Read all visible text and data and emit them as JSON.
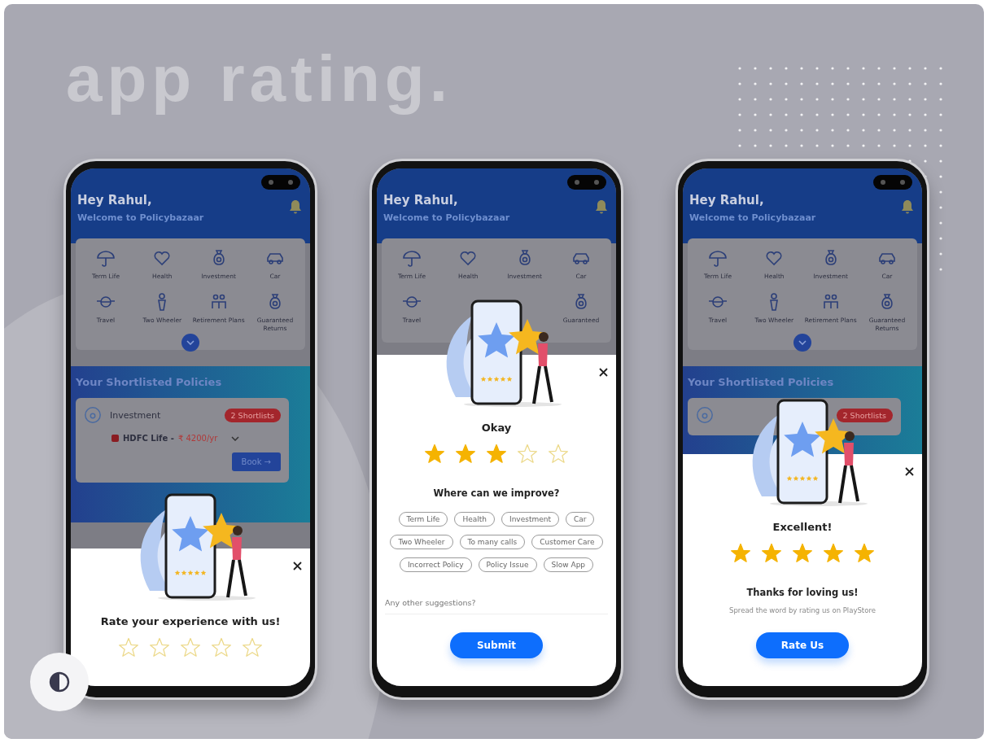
{
  "heading": "app rating.",
  "phones": [
    {
      "home": {
        "greeting": "Hey Rahul,",
        "welcome": "Welcome to Policybazaar",
        "category_rows": [
          [
            {
              "label": "Term Life",
              "kind": "umbrella"
            },
            {
              "label": "Health",
              "kind": "heart"
            },
            {
              "label": "Investment",
              "kind": "bag"
            },
            {
              "label": "Car",
              "kind": "car"
            }
          ],
          [
            {
              "label": "Travel",
              "kind": "globe"
            },
            {
              "label": "Two Wheeler",
              "kind": "person"
            },
            {
              "label": "Retirement Plans",
              "kind": "people"
            },
            {
              "label": "Guaranteed Returns",
              "kind": "bag"
            }
          ]
        ],
        "section_title": "Your Shortlisted Policies",
        "policy_card": {
          "title": "Investment",
          "badge": "2 Shortlists",
          "insurer": "HDFC Life -",
          "price": "₹ 4200/yr",
          "button": "Book →"
        }
      },
      "sheet": {
        "kind": "rate",
        "title": "Rate your experience with us!",
        "stars": 0
      }
    },
    {
      "home": {
        "greeting": "Hey Rahul,",
        "welcome": "Welcome to Policybazaar",
        "category_rows": [
          [
            {
              "label": "Term Life",
              "kind": "umbrella"
            },
            {
              "label": "Health",
              "kind": "heart"
            },
            {
              "label": "Investment",
              "kind": "bag"
            },
            {
              "label": "Car",
              "kind": "car"
            }
          ],
          [
            {
              "label": "Travel",
              "kind": "globe"
            },
            {
              "label": "Guaranteed",
              "kind": "bag"
            }
          ]
        ]
      },
      "sheet": {
        "kind": "feedback",
        "title": "Okay",
        "stars": 3,
        "question": "Where can we improve?",
        "chips": [
          "Term Life",
          "Health",
          "Investment",
          "Car",
          "Two Wheeler",
          "To many calls",
          "Customer Care",
          "Incorrect Policy",
          "Policy Issue",
          "Slow App"
        ],
        "placeholder": "Any other suggestions?",
        "button": "Submit"
      }
    },
    {
      "home": {
        "greeting": "Hey Rahul,",
        "welcome": "Welcome to Policybazaar",
        "category_rows": [
          [
            {
              "label": "Term Life",
              "kind": "umbrella"
            },
            {
              "label": "Health",
              "kind": "heart"
            },
            {
              "label": "Investment",
              "kind": "bag"
            },
            {
              "label": "Car",
              "kind": "car"
            }
          ],
          [
            {
              "label": "Travel",
              "kind": "globe"
            },
            {
              "label": "Two Wheeler",
              "kind": "person"
            },
            {
              "label": "Retirement Plans",
              "kind": "people"
            },
            {
              "label": "Guaranteed Returns",
              "kind": "bag"
            }
          ]
        ],
        "section_title": "Your Shortlisted Policies",
        "policy_card": {
          "badge": "2 Shortlists"
        }
      },
      "sheet": {
        "kind": "thanks",
        "title": "Excellent!",
        "stars": 5,
        "message": "Thanks for loving us!",
        "note": "Spread the word by rating us on PlayStore",
        "button": "Rate Us"
      }
    }
  ]
}
